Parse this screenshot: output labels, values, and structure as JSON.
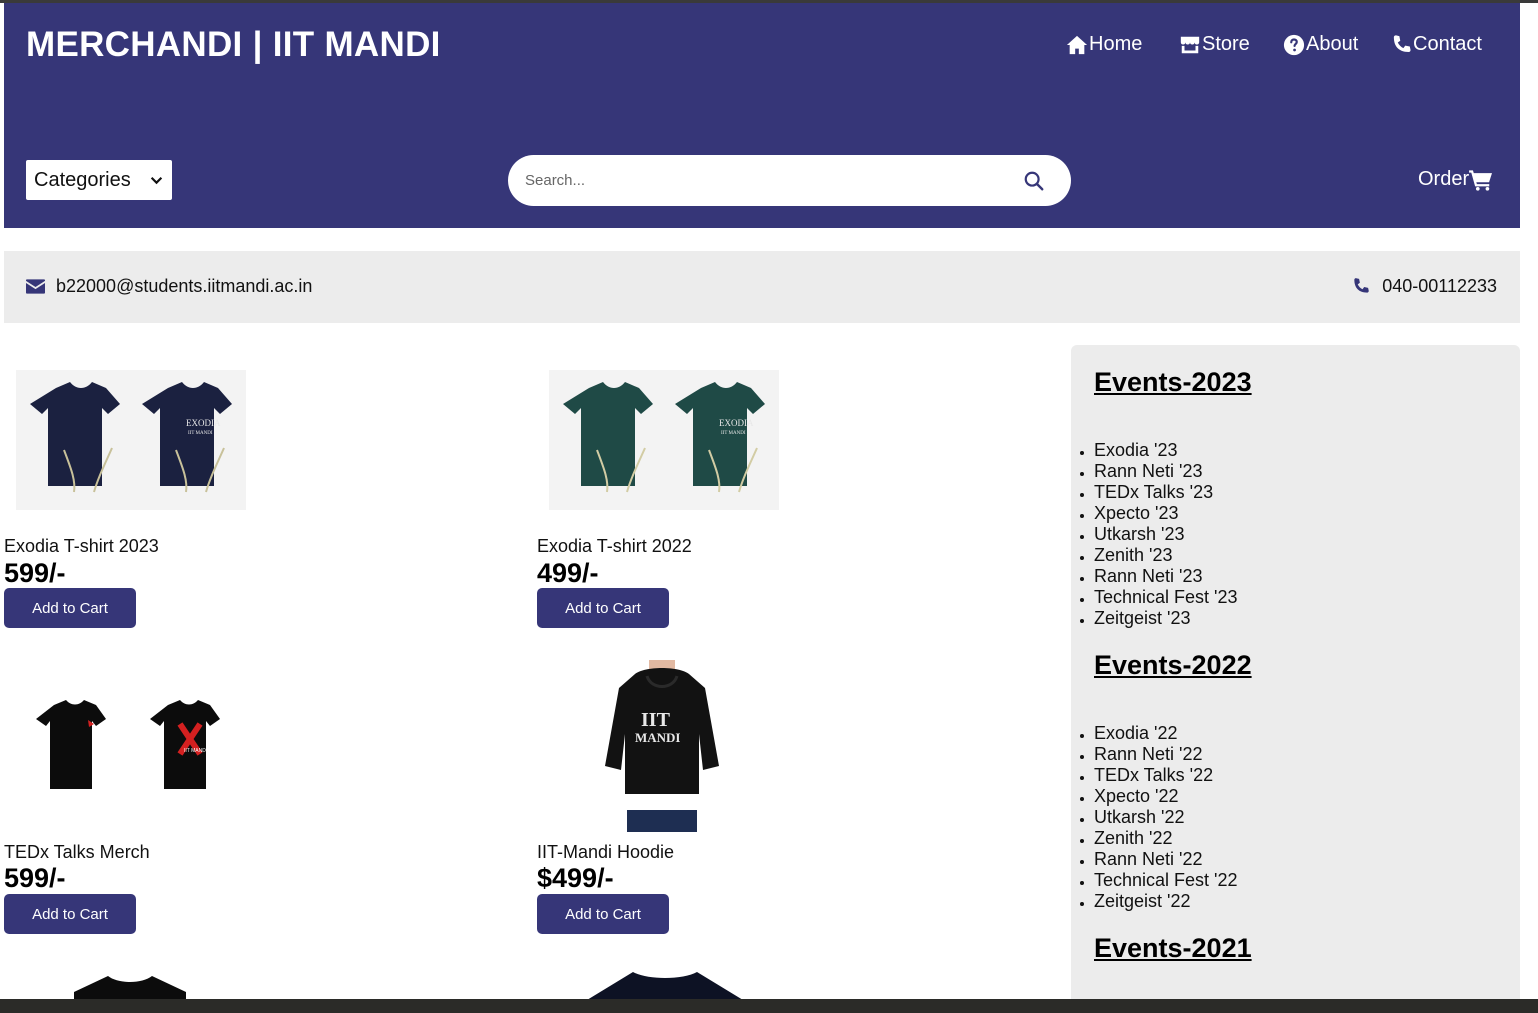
{
  "header": {
    "brand": "MERCHANDI | IIT MANDI",
    "nav": [
      {
        "label": "Home",
        "icon": "home-icon"
      },
      {
        "label": "Store",
        "icon": "store-icon"
      },
      {
        "label": "About",
        "icon": "question-circle-icon"
      },
      {
        "label": "Contact",
        "icon": "phone-icon"
      }
    ],
    "categories_label": "Categories",
    "search_placeholder": "Search...",
    "order_label": "Order",
    "bg_color": "#363678"
  },
  "contact_bar": {
    "email": "b22000@students.iitmandi.ac.in",
    "phone": "040-00112233"
  },
  "products": [
    {
      "name": "Exodia T-shirt 2023",
      "price": "599/-",
      "button": "Add to Cart",
      "image": "navy-exodia-tshirt"
    },
    {
      "name": "Exodia T-shirt 2022",
      "price": "499/-",
      "button": "Add to Cart",
      "image": "teal-exodia-tshirt"
    },
    {
      "name": "TEDx Talks Merch",
      "price": "599/-",
      "button": "Add to Cart",
      "image": "black-tedx-tshirt"
    },
    {
      "name": "IIT-Mandi Hoodie",
      "price": "$499/-",
      "button": "Add to Cart",
      "image": "black-hoodie"
    }
  ],
  "sidebar": {
    "events": [
      {
        "title": "Events-2023",
        "items": [
          "Exodia '23",
          "Rann Neti '23",
          "TEDx Talks '23",
          "Xpecto '23",
          "Utkarsh '23",
          "Zenith '23",
          "Rann Neti '23",
          "Technical Fest '23",
          "Zeitgeist '23"
        ]
      },
      {
        "title": "Events-2022",
        "items": [
          "Exodia '22",
          "Rann Neti '22",
          "TEDx Talks '22",
          "Xpecto '22",
          "Utkarsh '22",
          "Zenith '22",
          "Rann Neti '22",
          "Technical Fest '22",
          "Zeitgeist '22"
        ]
      },
      {
        "title": "Events-2021",
        "items": []
      }
    ]
  }
}
